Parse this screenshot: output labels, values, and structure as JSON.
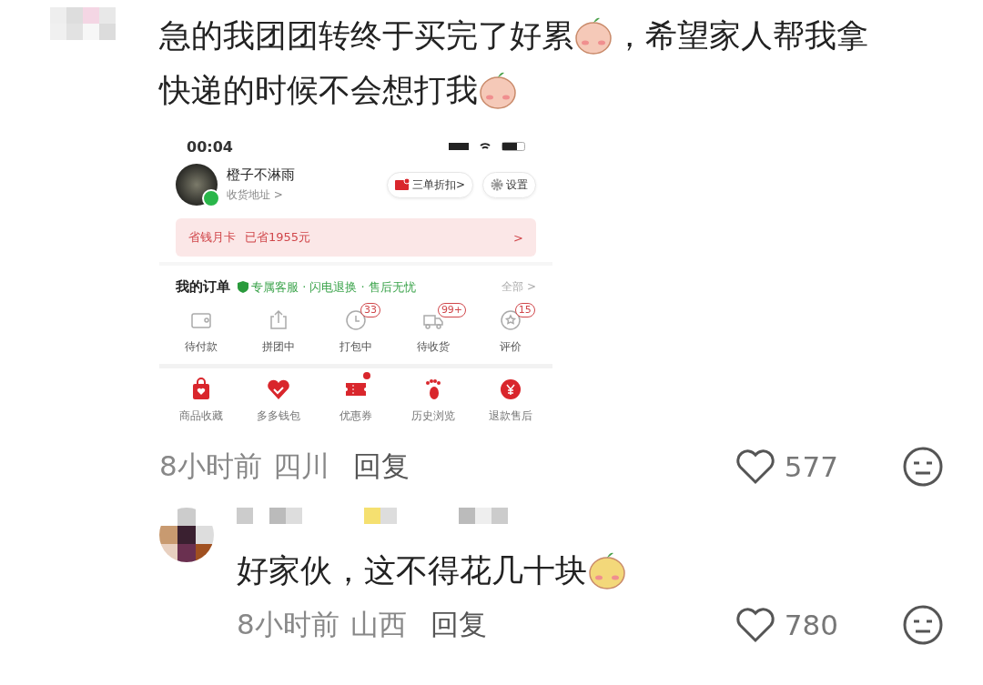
{
  "comment": {
    "body": [
      {
        "kind": "text",
        "text": "急的我团团转终于买完了好累"
      },
      {
        "kind": "emoji"
      },
      {
        "kind": "text",
        "text": "，希望家人帮我拿"
      },
      {
        "kind": "break"
      },
      {
        "kind": "text",
        "text": "快递的时候不会想打我"
      },
      {
        "kind": "emoji"
      }
    ],
    "screenshot": {
      "status_time": "00:04",
      "user_name": "橙子不淋雨",
      "address": "收货地址 >",
      "chips": [
        {
          "kind": "discount",
          "label": "三单折扣>"
        },
        {
          "kind": "settings",
          "label": "设置"
        }
      ],
      "savings": {
        "title": "省钱月卡",
        "amount": "已省1955元",
        "arrow": ">"
      },
      "orders": {
        "title": "我的订单",
        "promo": "专属客服 · 闪电退换 · 售后无忧",
        "all": "全部 >",
        "items": [
          {
            "kind": "wallet",
            "label": "待付款"
          },
          {
            "kind": "share",
            "label": "拼团中"
          },
          {
            "kind": "clock",
            "label": "打包中",
            "badge": "33"
          },
          {
            "kind": "truck",
            "label": "待收货",
            "badge": "99+"
          },
          {
            "kind": "review",
            "label": "评价",
            "badge": "15"
          }
        ]
      },
      "tools": [
        {
          "kind": "bag",
          "label": "商品收藏",
          "notified": false
        },
        {
          "kind": "heart",
          "label": "多多钱包",
          "notified": false
        },
        {
          "kind": "ticket",
          "label": "优惠券",
          "notified": true
        },
        {
          "kind": "foot",
          "label": "历史浏览",
          "notified": false
        },
        {
          "kind": "yen",
          "label": "退款售后",
          "notified": false
        }
      ]
    },
    "meta": {
      "time": "8小时前",
      "place": "四川",
      "reply": "回复",
      "likes": "577"
    }
  },
  "reply": {
    "body": [
      {
        "kind": "text",
        "text": "好家伙，这不得花几十块"
      },
      {
        "kind": "emoji"
      }
    ],
    "meta": {
      "time": "8小时前",
      "place": "山西",
      "reply": "回复",
      "likes": "780"
    }
  }
}
